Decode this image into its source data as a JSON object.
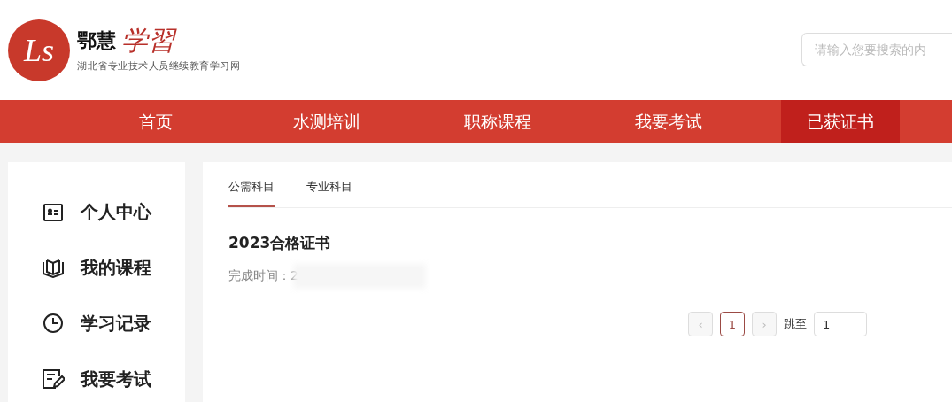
{
  "header": {
    "logo_mark": "Ls",
    "brand": "鄂慧",
    "brand_script": "学習",
    "tagline": "湖北省专业技术人员继续教育学习网",
    "search": {
      "placeholder": "请输入您要搜索的内"
    }
  },
  "nav": [
    {
      "label": "首页",
      "selected": false
    },
    {
      "label": "水测培训",
      "selected": false
    },
    {
      "label": "职称课程",
      "selected": false
    },
    {
      "label": "我要考试",
      "selected": false
    },
    {
      "label": "已获证书",
      "selected": true
    }
  ],
  "sidebar": {
    "items": [
      {
        "label": "个人中心"
      },
      {
        "label": "我的课程"
      },
      {
        "label": "学习记录"
      },
      {
        "label": "我要考试"
      }
    ]
  },
  "tabs": [
    {
      "label": "公需科目",
      "selected": true
    },
    {
      "label": "专业科目",
      "selected": false
    }
  ],
  "certificates": [
    {
      "title": "2023合格证书",
      "completed": "完成时间：2",
      "redacted": true
    }
  ],
  "pagination": {
    "prev": {
      "label": "‹",
      "disabled": true
    },
    "pages": [
      {
        "label": "1",
        "selected": true
      }
    ],
    "next": {
      "label": "›",
      "disabled": true
    },
    "jump_label": "跳至",
    "jump_value": "1"
  }
}
